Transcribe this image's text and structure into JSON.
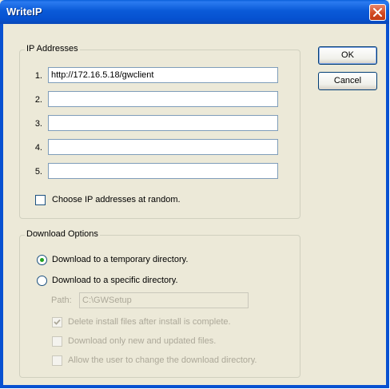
{
  "window": {
    "title": "WriteIP"
  },
  "ip_group": {
    "legend": "IP Addresses",
    "rows": [
      {
        "number": "1.",
        "value": "http://172.16.5.18/gwclient"
      },
      {
        "number": "2.",
        "value": ""
      },
      {
        "number": "3.",
        "value": ""
      },
      {
        "number": "4.",
        "value": ""
      },
      {
        "number": "5.",
        "value": ""
      }
    ],
    "random_label": "Choose IP addresses at random.",
    "random_checked": false
  },
  "download_group": {
    "legend": "Download Options",
    "temp_dir_label": "Download to a temporary directory.",
    "specific_dir_label": "Download to a specific directory.",
    "selected": "temp_dir",
    "path_label": "Path:",
    "path_value": "C:\\GWSetup",
    "delete_files_label": "Delete install files after install is complete.",
    "delete_files_checked": true,
    "only_new_label": "Download only new and updated files.",
    "only_new_checked": false,
    "allow_change_label": "Allow the user to change the download directory.",
    "allow_change_checked": false
  },
  "buttons": {
    "ok": "OK",
    "cancel": "Cancel"
  },
  "icons": {
    "close": "close-icon",
    "check": "checkmark-icon"
  },
  "colors": {
    "title_bar": "#0a5ad8",
    "close_button": "#d24a22",
    "dialog_bg": "#ece9d8"
  }
}
